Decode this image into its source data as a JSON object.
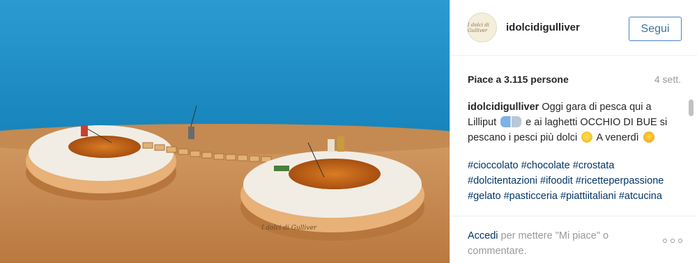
{
  "photo": {
    "watermark": "I dolci di Gulliver"
  },
  "header": {
    "avatar_text": "I dolci di Gulliver",
    "username": "idolcidigulliver",
    "follow_label": "Segui"
  },
  "stats": {
    "likes": "Piace a 3.115 persone",
    "time": "4 sett."
  },
  "caption": {
    "username": "idolcidigulliver",
    "text_1": " Oggi gara di pesca qui a Lilliput ",
    "text_2": " e ai laghetti OCCHIO DI BUE  si pescano i pesci più dolci ",
    "text_3": "  A venerdì ",
    "hashtags": [
      "#cioccolato",
      "#chocolate",
      "#crostata",
      "#dolcitentazioni",
      "#ifoodit",
      "#ricetteperpassione",
      "#gelato",
      "#pasticceria",
      "#piattiitaliani",
      "#atcucina"
    ]
  },
  "footer": {
    "login_link": "Accedi",
    "login_rest": " per mettere \"Mi piace\" o commentare."
  },
  "colors": {
    "sky": "#1f8fc4",
    "table": "#c98d54",
    "link": "#003569",
    "follow_border": "#4d7fc9"
  },
  "icons": {
    "more": "more-options-icon",
    "fish": "fish-emoji-icon",
    "smile": "grin-emoji-icon",
    "kiss": "kiss-emoji-icon"
  }
}
